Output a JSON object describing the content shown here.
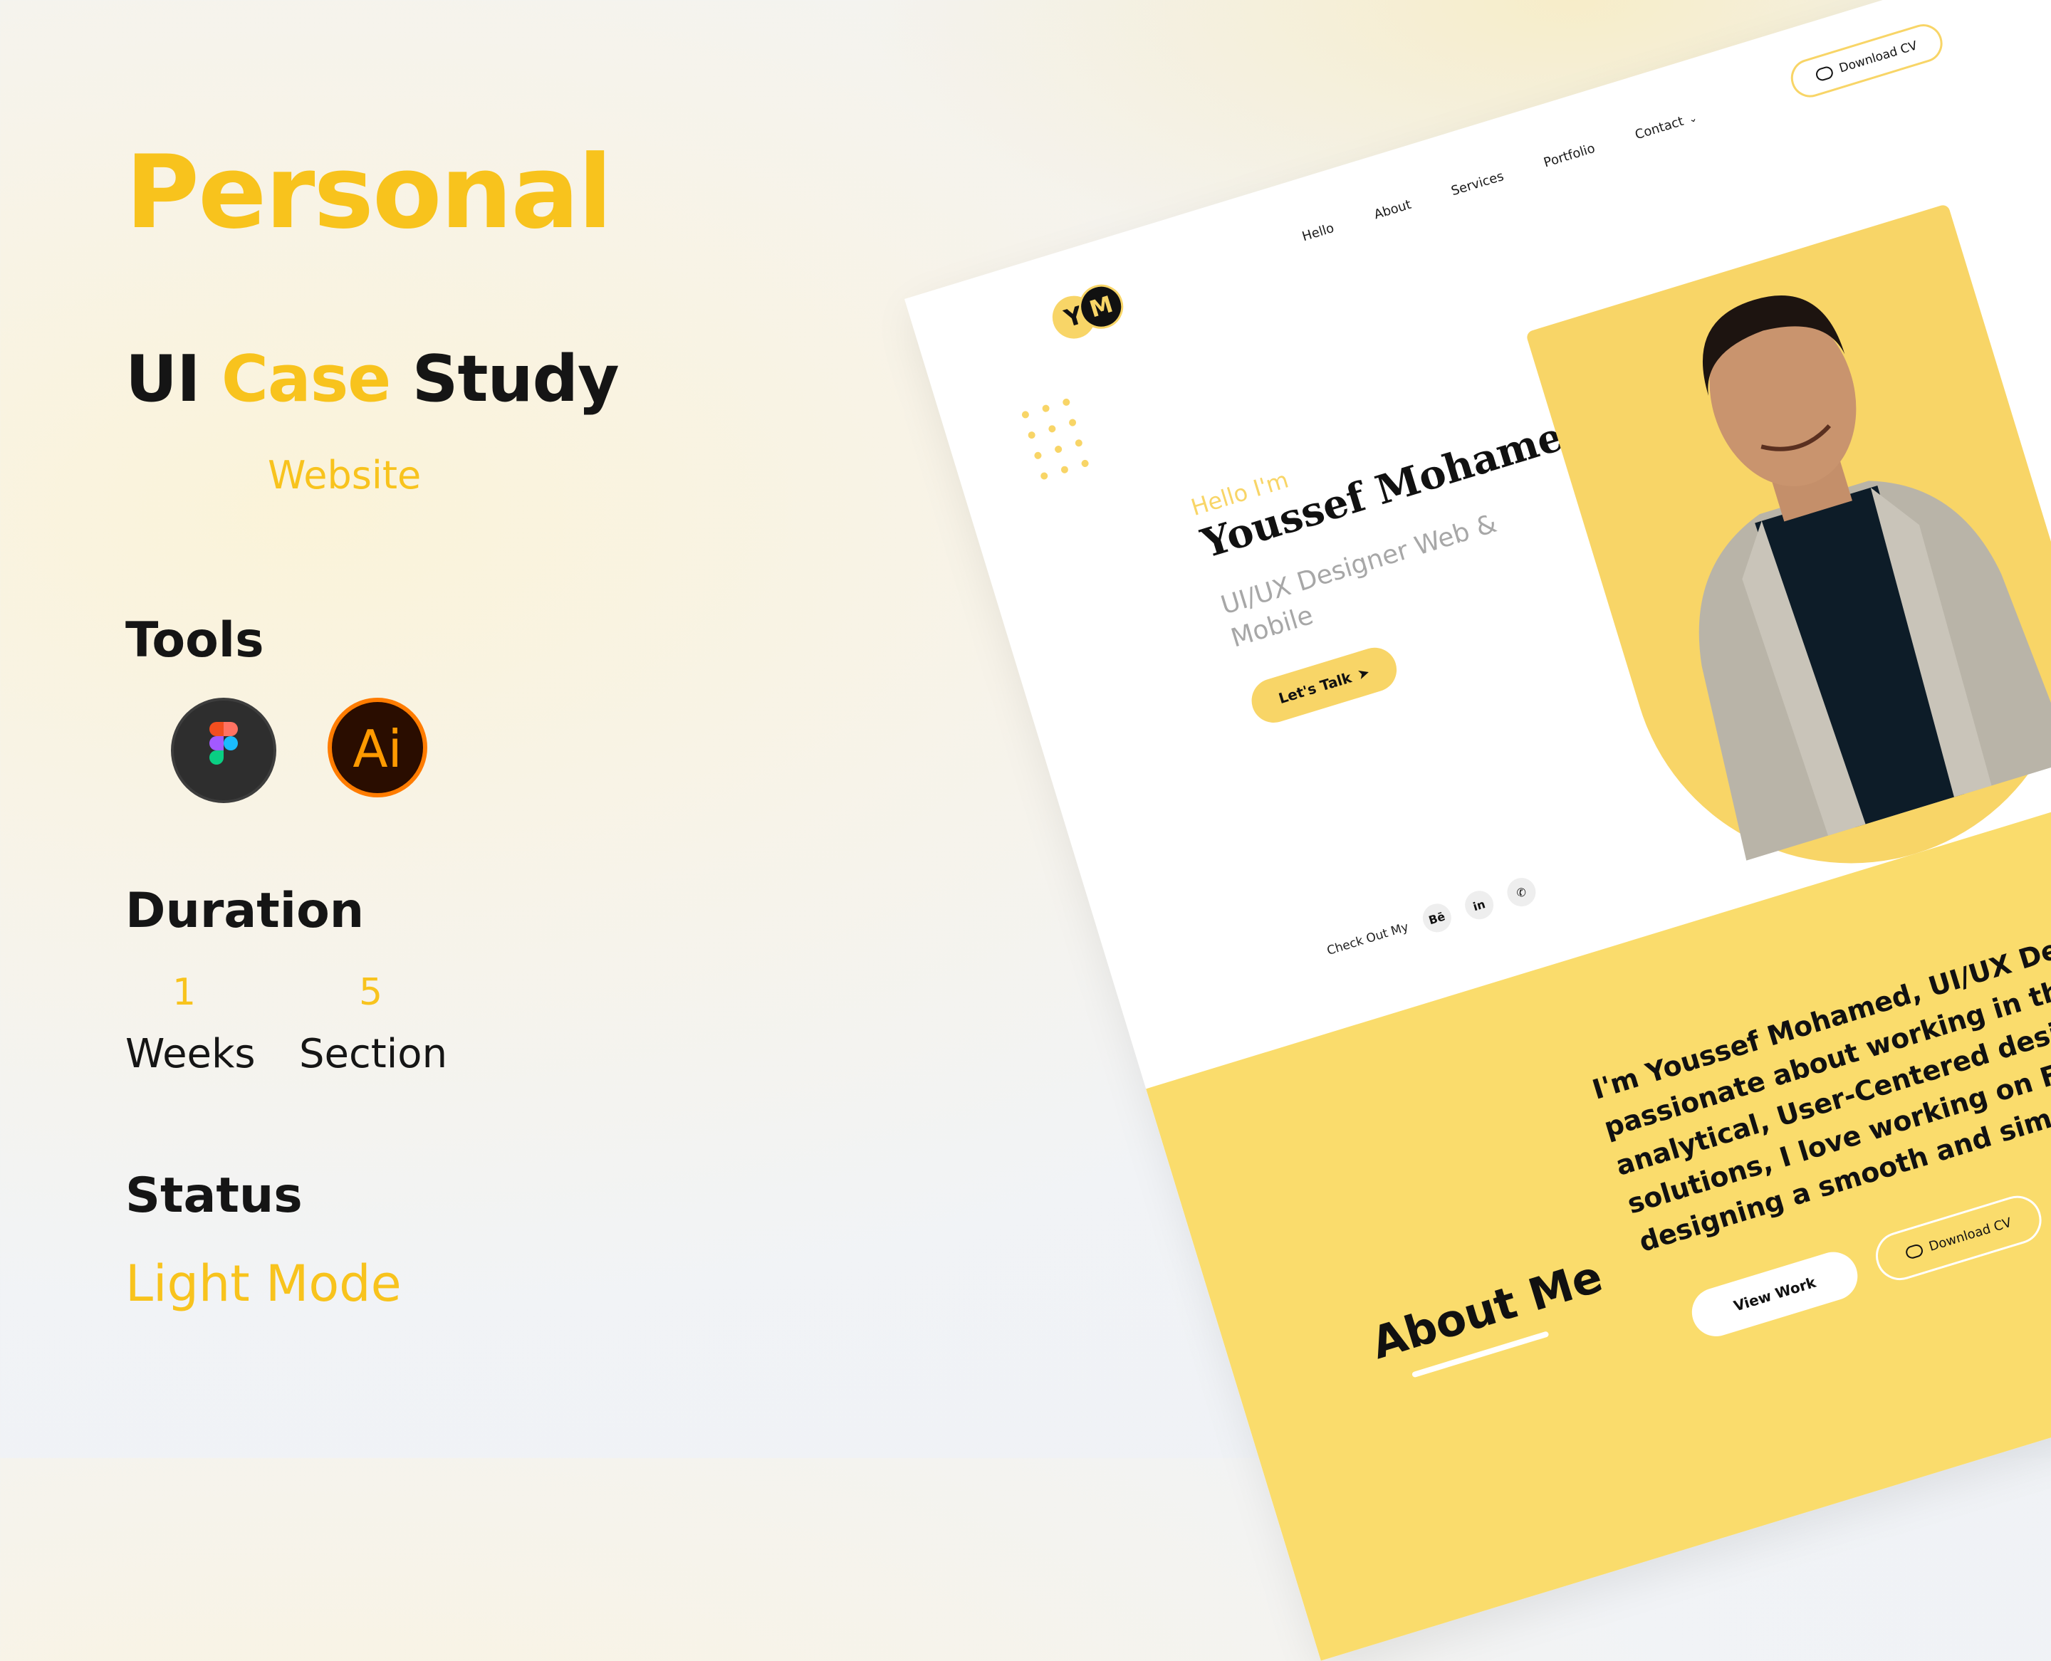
{
  "left": {
    "title": "Personal",
    "case_part1": "UI",
    "case_part2": "Case",
    "case_part3": "Study",
    "subtitle": "Website",
    "tools_label": "Tools",
    "tools": [
      "figma-icon",
      "illustrator-icon"
    ],
    "illustrator_text": "Ai",
    "duration_label": "Duration",
    "duration": [
      {
        "value": "1",
        "unit": "Weeks"
      },
      {
        "value": "5",
        "unit": "Section"
      }
    ],
    "status_label": "Status",
    "status_value": "Light Mode"
  },
  "mockup": {
    "logo_y": "Y",
    "logo_m": "M",
    "nav": [
      "Hello",
      "About",
      "Services",
      "Portfolio",
      "Contact"
    ],
    "download_cv": "Download CV",
    "hero": {
      "greeting": "Hello I'm",
      "name": "Youssef Mohamed",
      "role": "UI/UX Designer Web & Mobile",
      "cta": "Let's Talk"
    },
    "social": {
      "label": "Check Out My",
      "items": [
        "Bē",
        "in",
        "✆"
      ]
    },
    "about": {
      "title": "About Me",
      "text": "I'm Youssef Mohamed, UI/UX Designer, trained at Route, passionate about working in the field, I apply strong analytical, User-Centered design skills to create friendly solutions, I love working on Figma, and I am keen on designing a smooth and simple UI/UX.",
      "view_work": "View Work",
      "download_cv": "Download CV"
    }
  },
  "colors": {
    "accent": "#f8c31d",
    "mock_yellow": "#f8d567",
    "dark": "#151515"
  }
}
